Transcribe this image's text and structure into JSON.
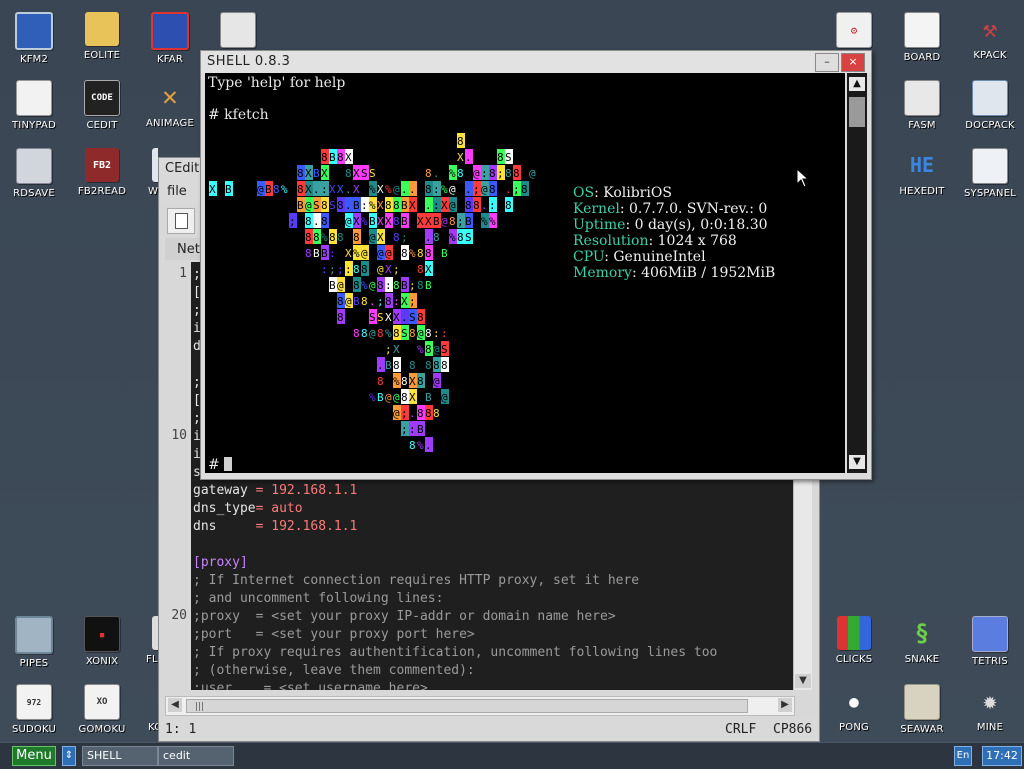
{
  "desktop_icons": {
    "kfm2": "KFM2",
    "eolite": "EOLITE",
    "kfar": "KFAR",
    "tinypad": "TINYPAD",
    "cedit": "CEDIT",
    "animage": "ANIMAGE",
    "rdsave": "RDSAVE",
    "fb2read": "FB2READ",
    "we": "WE",
    "board": "BOARD",
    "kpack": "KPACK",
    "fasm": "FASM",
    "docpack": "DOCPACK",
    "hexedit": "HEXEDIT",
    "syspanel": "SYSPANEL",
    "pipes": "PIPES",
    "xonix": "XONIX",
    "fl": "FL",
    "sudoku": "SUDOKU",
    "gomoku": "GOMOKU",
    "ko": "KO",
    "clicks": "CLICKS",
    "snake": "SNAKE",
    "tetris": "TETRIS",
    "pong": "PONG",
    "seawar": "SEAWAR",
    "mine": "MINE",
    "cedit_glyph": "CODE",
    "fb2_glyph": "FB2",
    "hexedit_glyph": "HE"
  },
  "cedit_window": {
    "title": "CEdit",
    "menu_file": "file",
    "tab": "Net",
    "gutter": {
      "l1": "1",
      "l10": "10",
      "l20": "20"
    },
    "lines_partial": [
      ";",
      "[",
      ";",
      "i",
      "d",
      ";",
      "[",
      ";",
      "i",
      "i",
      "s"
    ],
    "gateway_key": "gateway",
    "gateway_eq": " = ",
    "gateway_val": "192.168.1.1",
    "dnstype_key": "dns_type",
    "dnstype_eq": "= ",
    "dnstype_val": "auto",
    "dns_key": "dns     ",
    "dns_eq": "= ",
    "dns_val": "192.168.1.1",
    "proxy_section": "[proxy]",
    "cmt1": "; If Internet connection requires HTTP proxy, set it here",
    "cmt2": "; and uncomment following lines:",
    "cmt3": ";proxy  = <set your proxy IP-addr or domain name here>",
    "cmt4": ";port   = <set your proxy port here>",
    "cmt5": "; If proxy requires authentification, uncomment following lines too",
    "cmt6": "; (otherwise, leave them commented):",
    "cmt7": ";user    = <set username here>",
    "status_pos": "1: 1",
    "status_eol": "CRLF",
    "status_cp": "CP866"
  },
  "shell_window": {
    "title": "SHELL 0.8.3",
    "min_label": "–",
    "close_label": "×",
    "line_help": "Type 'help' for help",
    "line_cmd": "# kfetch",
    "line_prompt": "# ",
    "info": {
      "os_k": "OS",
      "os_v": ": KolibriOS",
      "kernel_k": "Kernel",
      "kernel_v": ": 0.7.7.0. SVN-rev.: 0",
      "uptime_k": "Uptime",
      "uptime_v": ": 0 day(s), 0:0:18.30",
      "res_k": "Resolution",
      "res_v": ": 1024 x 768",
      "cpu_k": "CPU",
      "cpu_v": ": GenuineIntel",
      "mem_k": "Memory",
      "mem_v": ": 406MiB / 1952MiB"
    }
  },
  "taskbar": {
    "menu": "Menu",
    "switch": "⇕",
    "task_shell": "SHELL",
    "task_cedit": "cedit",
    "lang": "En",
    "clock": "17:42"
  },
  "colors": {
    "desktop": "#3d4a57",
    "info_key": "#3ecfaa",
    "editor_bg": "#1f1f1f",
    "ini_value": "#ff7a7a",
    "ini_section": "#c584ff",
    "comment": "#9a9a9a",
    "menu_green": "#1f7a2a",
    "taskbar_blue": "#2f6fb5"
  }
}
